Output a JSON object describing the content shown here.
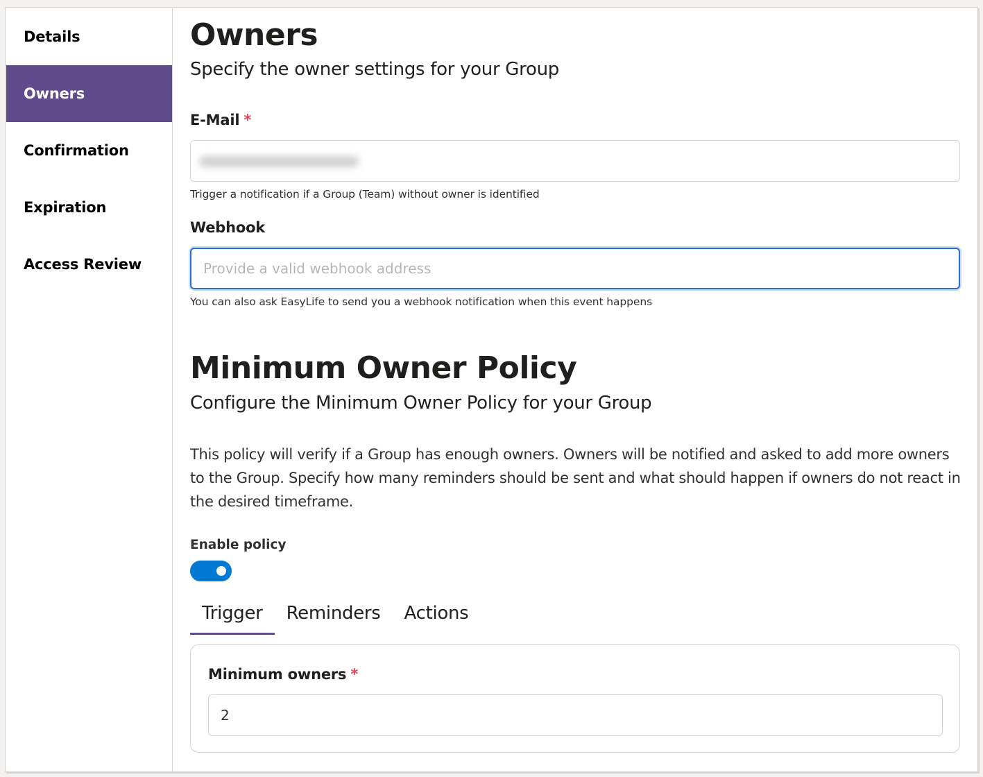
{
  "sidebar": {
    "items": [
      {
        "label": "Details",
        "active": false
      },
      {
        "label": "Owners",
        "active": true
      },
      {
        "label": "Confirmation",
        "active": false
      },
      {
        "label": "Expiration",
        "active": false
      },
      {
        "label": "Access Review",
        "active": false
      }
    ]
  },
  "header": {
    "title": "Owners",
    "subtitle": "Specify the owner settings for your Group"
  },
  "email": {
    "label": "E-Mail",
    "required_mark": "*",
    "value_redacted": true,
    "hint": "Trigger a notification if a Group (Team) without owner is identified"
  },
  "webhook": {
    "label": "Webhook",
    "value": "",
    "placeholder": "Provide a valid webhook address",
    "hint": "You can also ask EasyLife to send you a webhook notification when this event happens"
  },
  "policy": {
    "title": "Minimum Owner Policy",
    "subtitle": "Configure the Minimum Owner Policy for your Group",
    "description": "This policy will verify if a Group has enough owners. Owners will be notified and asked to add more owners to the Group. Specify how many reminders should be sent and what should happen if owners do not react in the desired timeframe.",
    "enable_label": "Enable policy",
    "enabled": true,
    "tabs": [
      {
        "label": "Trigger",
        "active": true
      },
      {
        "label": "Reminders",
        "active": false
      },
      {
        "label": "Actions",
        "active": false
      }
    ],
    "trigger": {
      "min_owners_label": "Minimum owners",
      "required_mark": "*",
      "min_owners_value": "2"
    }
  },
  "colors": {
    "accent_purple": "#5f4b8b",
    "toggle_blue": "#0078d4",
    "required_red": "#e0465d",
    "focus_blue": "#2b6fd6"
  }
}
